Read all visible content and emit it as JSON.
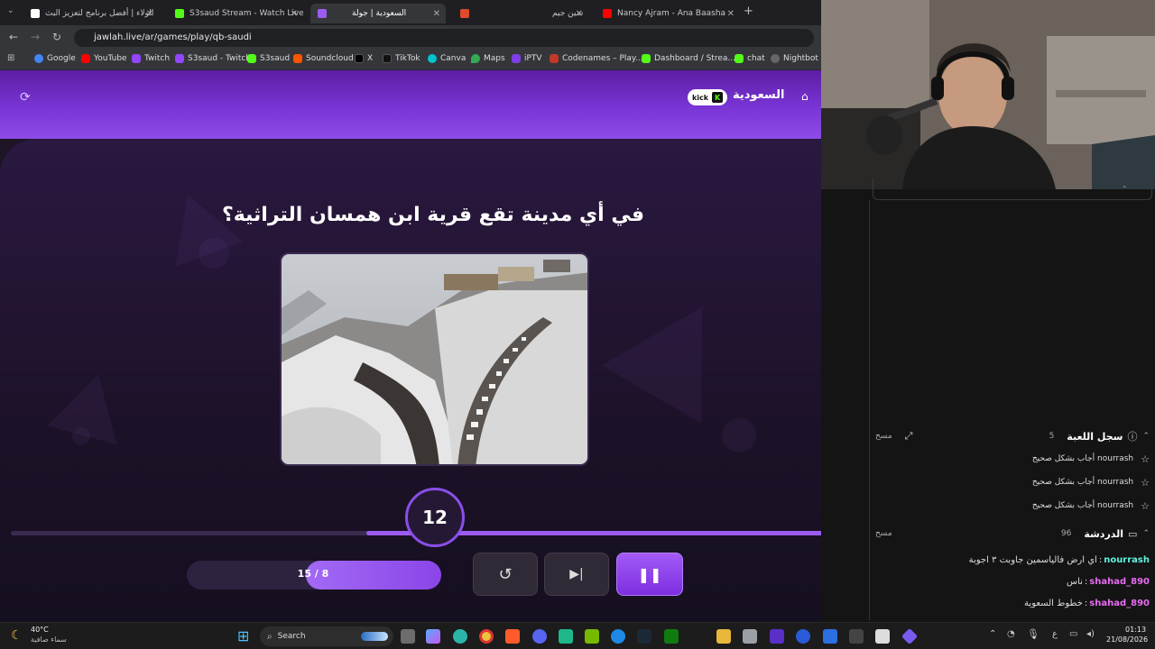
{
  "browser": {
    "tabs": [
      {
        "label": "الولاء | أفضل برنامج لتعزيز البث",
        "color": "#ffffff"
      },
      {
        "label": "S3saud Stream - Watch Live on",
        "color": "#53fc18"
      },
      {
        "label": "السعودية | جولة",
        "color": "#9b5cf0",
        "active": true
      },
      {
        "label": "",
        "color": "#e04b2b"
      },
      {
        "label": "سين جيم",
        "color": "#ffffff"
      },
      {
        "label": "Nancy Ajram - Ana Baasha",
        "color": "#ff0000"
      }
    ],
    "new_tab": "+",
    "url": "jawlah.live/ar/games/play/qb-saudi",
    "bookmarks": [
      {
        "label": "Google",
        "color": "#4285f4"
      },
      {
        "label": "YouTube",
        "color": "#ff0000"
      },
      {
        "label": "Twitch",
        "color": "#9146ff"
      },
      {
        "label": "S3saud - Twitch",
        "color": "#9146ff"
      },
      {
        "label": "S3saud",
        "color": "#53fc18"
      },
      {
        "label": "Soundcloud",
        "color": "#ff5500"
      },
      {
        "label": "X",
        "color": "#000000"
      },
      {
        "label": "TikTok",
        "color": "#111111"
      },
      {
        "label": "Canva",
        "color": "#00c4cc"
      },
      {
        "label": "Maps",
        "color": "#34a853"
      },
      {
        "label": "iPTV",
        "color": "#7b3fe4"
      },
      {
        "label": "Codenames – Play...",
        "color": "#c0392b"
      },
      {
        "label": "Dashboard / Strea...",
        "color": "#53fc18"
      },
      {
        "label": "chat",
        "color": "#53fc18"
      },
      {
        "label": "Nightbot",
        "color": "#3c3c3c"
      }
    ]
  },
  "game": {
    "header_title": "السعودية",
    "kick_badge": "kick",
    "kick_logo": "K",
    "question": "في أي مدينة تقع قرية ابن همسان التراثية؟",
    "timer": "12",
    "question_counter": "15 / 8",
    "question_progress": 0.53,
    "time_progress": 0.58
  },
  "panel": {
    "game_log": {
      "title": "سجل اللعبة",
      "count": "5",
      "clear": "مسح"
    },
    "log_entries": [
      {
        "text": "nourrash أجاب بشكل صحيح"
      },
      {
        "text": "nourrash أجاب بشكل صحيح"
      },
      {
        "text": "nourrash أجاب بشكل صحيح"
      }
    ],
    "chat": {
      "title": "الدردشة",
      "count": "96",
      "clear": "مسح"
    },
    "messages": [
      {
        "user": "nourrash",
        "text": "اي ارض فالياسمين جاوبت ٣ اجوبة",
        "color": "#5ef2e1"
      },
      {
        "user": "shahad_890",
        "text": "ناس",
        "color": "#e86cf2"
      },
      {
        "user": "shahad_890",
        "text": "خطوط السعوية",
        "color": "#e86cf2"
      }
    ]
  },
  "taskbar": {
    "weather_temp": "40°C",
    "weather_desc": "سماء صافية",
    "search": "Search",
    "lang": "ع",
    "time": "01:13",
    "date": "21/08/2026"
  }
}
